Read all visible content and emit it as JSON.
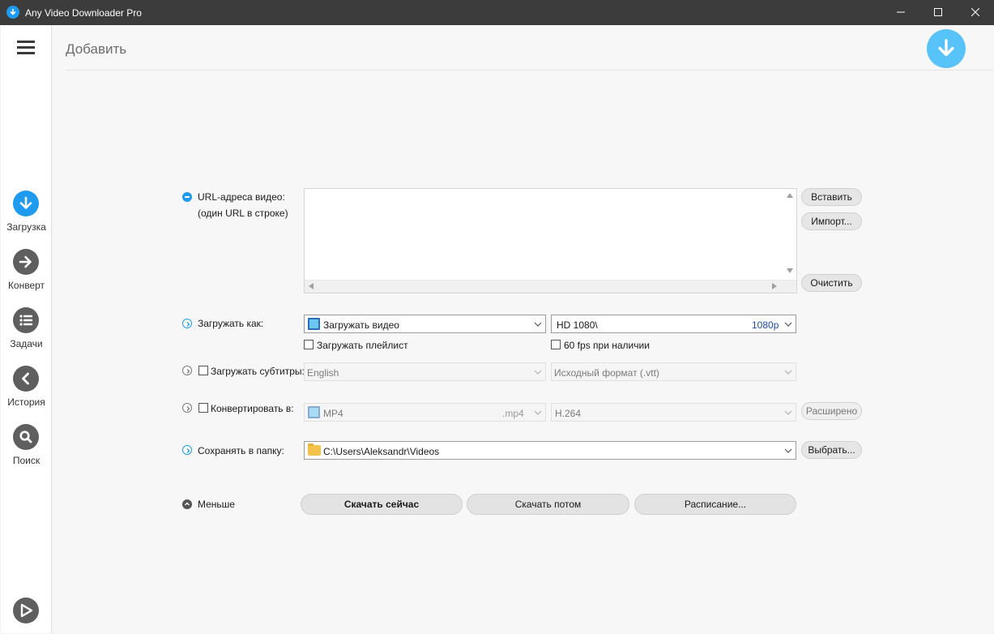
{
  "app": {
    "title": "Any Video Downloader Pro",
    "window_controls": [
      "minimize-icon",
      "maximize-icon",
      "close-icon"
    ]
  },
  "colors": {
    "accent": "#1e9bf0",
    "titlebar": "#3c3c3c",
    "nav_icon": "#5f5f5f",
    "big_download": "#58c3f8"
  },
  "sidebar": {
    "menu_icon": "hamburger-icon",
    "items": [
      {
        "label": "Загрузка",
        "icon": "download-icon",
        "active": true
      },
      {
        "label": "Конверт",
        "icon": "arrow-right-icon",
        "active": false
      },
      {
        "label": "Задачи",
        "icon": "list-icon",
        "active": false
      },
      {
        "label": "История",
        "icon": "chevron-left-icon",
        "active": false
      },
      {
        "label": "Поиск",
        "icon": "search-icon",
        "active": false
      }
    ],
    "bottom_icon": "play-icon"
  },
  "header": {
    "title": "Добавить",
    "action_icon": "download-icon"
  },
  "form": {
    "url": {
      "label_line1": "URL-адреса видео:",
      "label_line2": "(один URL в строке)",
      "value": "",
      "paste_label": "Вставить",
      "import_label": "Импорт...",
      "clear_label": "Очистить"
    },
    "download_as": {
      "label": "Загружать как:",
      "type_value": "Загружать видео",
      "quality_value": "HD 1080\\",
      "quality_badge": "1080p",
      "playlist_label": "Загружать плейлист",
      "playlist_checked": false,
      "fps_label": "60 fps при наличии",
      "fps_checked": false
    },
    "subtitles": {
      "label": "Загружать субтитры:",
      "checked": false,
      "language_value": "English",
      "format_value": "Исходный формат (.vtt)"
    },
    "convert": {
      "label": "Конвертировать в:",
      "checked": false,
      "format_value": "MP4",
      "format_ext": ".mp4",
      "codec_value": "H.264",
      "advanced_label": "Расширено"
    },
    "save_to": {
      "label": "Сохранять в папку:",
      "path_value": "C:\\Users\\Aleksandr\\Videos",
      "browse_label": "Выбрать..."
    },
    "less_label": "Меньше",
    "actions": {
      "download_now": "Скачать сейчас",
      "download_later": "Скачать потом",
      "schedule": "Расписание..."
    }
  }
}
